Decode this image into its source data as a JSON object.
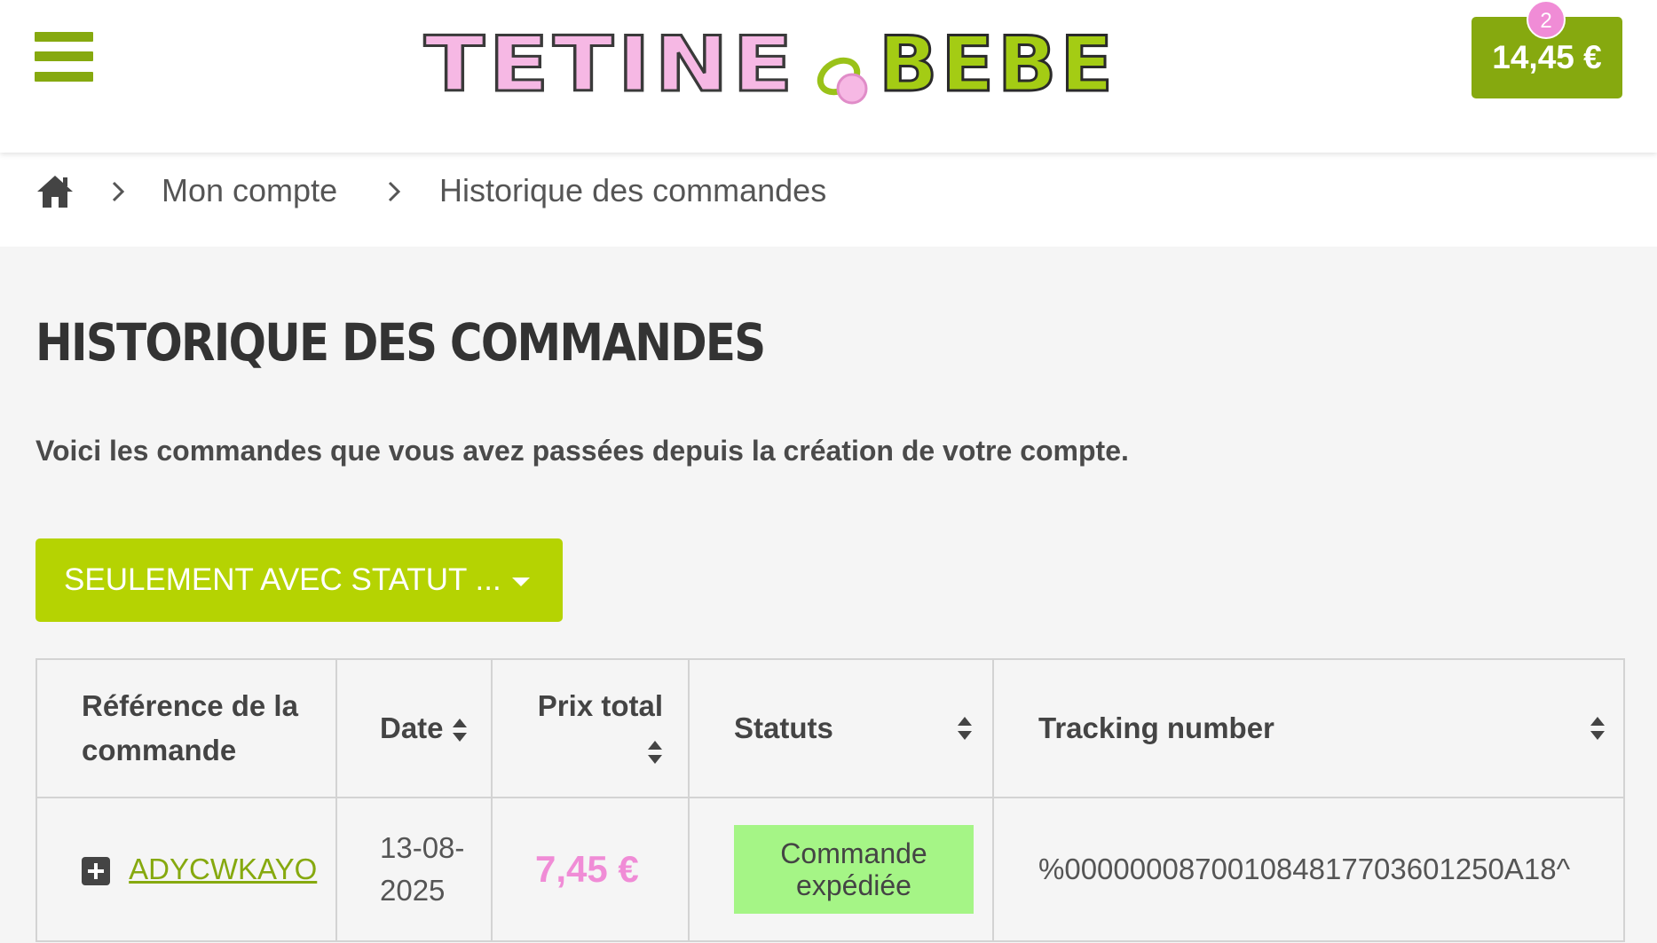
{
  "header": {
    "menu_icon": "hamburger-menu-icon",
    "logo_text_left": "TETINE",
    "logo_text_right": "BEBE",
    "logo_icon": "pacifier-icon",
    "cart_total": "14,45 €",
    "cart_count": "2",
    "colors": {
      "brand_green": "#86a90f",
      "brand_pink": "#f08cd6",
      "filter_green": "#b5d302",
      "status_green": "#a5f586"
    }
  },
  "breadcrumb": {
    "home_icon": "home-icon",
    "items": [
      "Mon compte",
      "Historique des commandes"
    ]
  },
  "main": {
    "title": "HISTORIQUE DES COMMANDES",
    "intro": "Voici les commandes que vous avez passées depuis la création de votre compte.",
    "filter_label": "SEULEMENT AVEC STATUT ..."
  },
  "table": {
    "headers": {
      "reference_line1": "Référence de la",
      "reference_line2": "commande",
      "date": "Date",
      "total": "Prix total",
      "status": "Statuts",
      "tracking": "Tracking number"
    },
    "rows": [
      {
        "reference": "ADYCWKAYO",
        "date_line1": "13-08-",
        "date_line2": "2025",
        "total": "7,45 €",
        "status_line1": "Commande",
        "status_line2": "expédiée",
        "tracking": "%0000000870010848177036012​50A18^"
      }
    ]
  }
}
